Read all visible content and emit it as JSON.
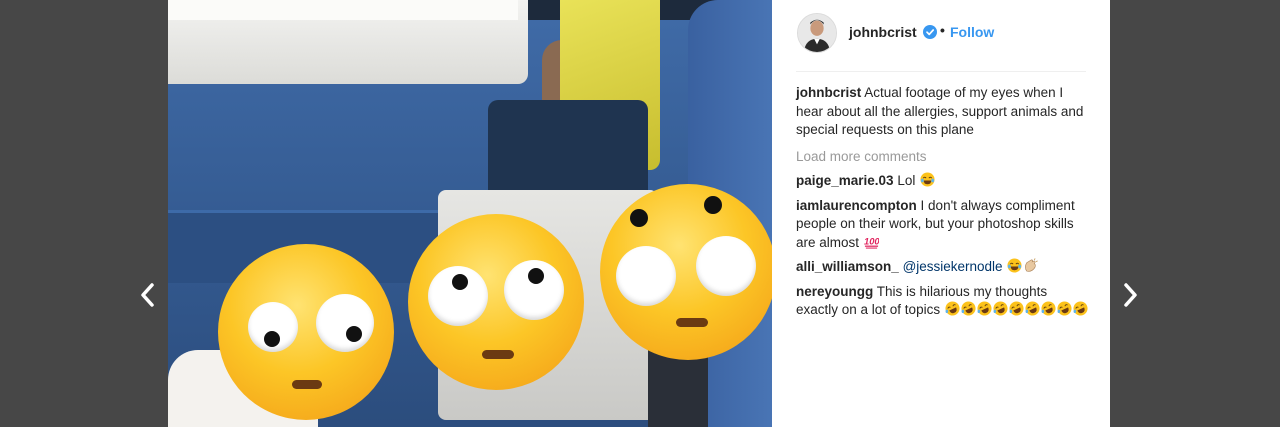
{
  "navigation": {
    "prev_icon": "chevron-left-icon",
    "next_icon": "chevron-right-icon"
  },
  "photo": {
    "emoji_name": "face-with-rolling-eyes",
    "count": 3
  },
  "post": {
    "username": "johnbcrist",
    "verified_icon": "verified-badge-icon",
    "separator": "•",
    "follow_label": "Follow",
    "caption": {
      "username": "johnbcrist",
      "text": "Actual footage of my eyes when I hear about all the allergies, support animals and special requests on this plane"
    },
    "load_more_label": "Load more comments",
    "comments": [
      {
        "username": "paige_marie.03",
        "text": "Lol",
        "emojis": [
          "face-with-tears-of-joy"
        ]
      },
      {
        "username": "iamlaurencompton",
        "text": "I don't always compliment people on their work, but your photoshop skills are almost",
        "emojis": [
          "hundred-points"
        ]
      },
      {
        "username": "alli_williamson_",
        "mention": "@jessiekernodle",
        "emojis": [
          "face-with-tears-of-joy",
          "clapping-hands"
        ]
      },
      {
        "username": "nereyoungg",
        "text": "This is hilarious my thoughts exactly on a lot of topics",
        "emojis": [
          "rolling-on-floor-laughing",
          "rolling-on-floor-laughing",
          "rolling-on-floor-laughing",
          "rolling-on-floor-laughing",
          "rolling-on-floor-laughing",
          "rolling-on-floor-laughing",
          "rolling-on-floor-laughing",
          "rolling-on-floor-laughing",
          "rolling-on-floor-laughing"
        ]
      }
    ]
  },
  "colors": {
    "link_blue": "#3897f0",
    "text": "#262626",
    "muted": "#999999",
    "backdrop": "#474747"
  }
}
